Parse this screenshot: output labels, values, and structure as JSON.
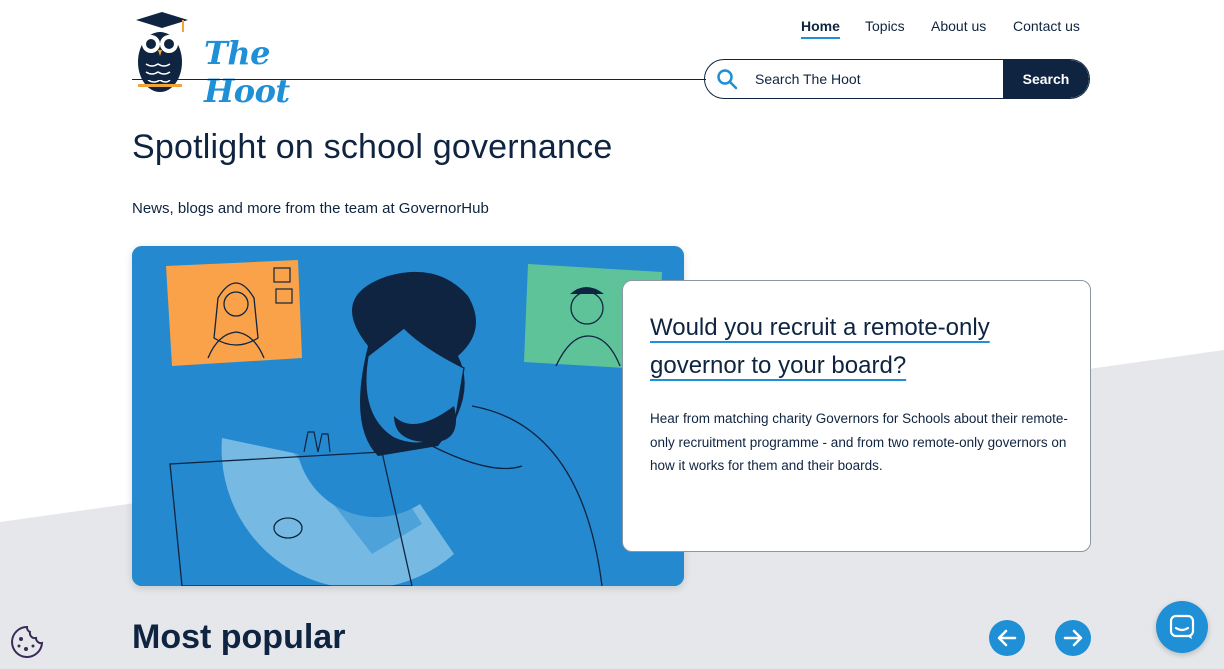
{
  "brand": {
    "name": "The Hoot",
    "accent": "#1f8fd6",
    "navy": "#0f2440"
  },
  "nav": {
    "items": [
      {
        "label": "Home",
        "active": true
      },
      {
        "label": "Topics",
        "active": false
      },
      {
        "label": "About us",
        "active": false
      },
      {
        "label": "Contact us",
        "active": false
      }
    ]
  },
  "search": {
    "placeholder": "Search The Hoot",
    "button_label": "Search",
    "icon": "search-icon"
  },
  "page": {
    "title": "Spotlight on school governance",
    "subtitle": "News, blogs and more from the team at GovernorHub"
  },
  "featured": {
    "title": "Would you recruit a remote-only governor to your board?",
    "summary": "Hear from matching charity Governors for Schools about their remote-only recruitment programme -  and from two remote-only governors on how it works for them and their boards."
  },
  "popular": {
    "title": "Most popular",
    "prev_icon": "arrow-left-icon",
    "next_icon": "arrow-right-icon"
  },
  "widgets": {
    "cookie_icon": "cookie-icon",
    "chat_icon": "chat-icon"
  }
}
